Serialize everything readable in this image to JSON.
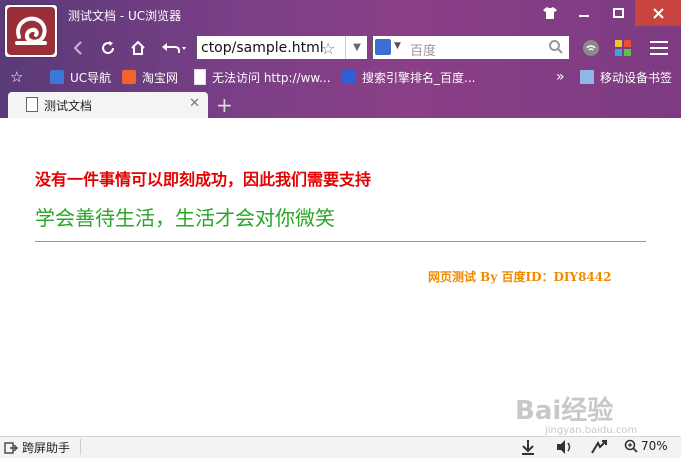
{
  "window": {
    "title": "测试文档 - UC浏览器"
  },
  "toolbar": {
    "address_text": "ctop/sample.html",
    "search_placeholder": "百度"
  },
  "bookmarks": [
    {
      "label": "UC导航",
      "icon": "uc-nav-icon"
    },
    {
      "label": "淘宝网",
      "icon": "taobao-icon"
    },
    {
      "label": "无法访问 http://ww...",
      "icon": "page-icon"
    },
    {
      "label": "搜索引擎排名_百度...",
      "icon": "baidu-icon"
    }
  ],
  "bookmarks_more": "»",
  "mobile_bookmarks": "移动设备书签",
  "tab": {
    "title": "测试文档"
  },
  "content": {
    "line1": "没有一件事情可以即刻成功，因此我们需要支持",
    "line2": "学会善待生活，生活才会对你微笑",
    "credit": "网页测试 By 百度ID：DIY8442",
    "watermark": "Bai经验",
    "watermark_sub": "jingyan.baidu.com"
  },
  "statusbar": {
    "assistant": "跨屏助手",
    "zoom": "70%"
  },
  "colors": {
    "chrome": "#7a3f86",
    "line1": "#e60000",
    "line2": "#2aa52a",
    "credit": "#f08a00"
  }
}
